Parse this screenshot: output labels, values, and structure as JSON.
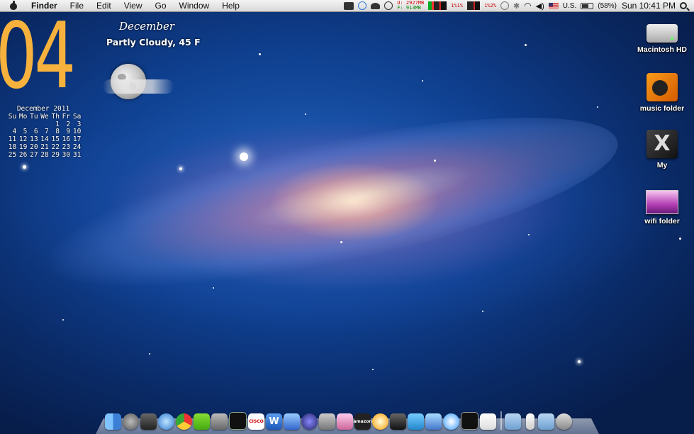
{
  "menubar": {
    "app_name": "Finder",
    "menus": [
      "File",
      "Edit",
      "View",
      "Go",
      "Window",
      "Help"
    ],
    "memory_used": "U: 2927MB",
    "memory_free": "F:  913MB",
    "cpu_1_a": "1%",
    "cpu_1_b": "1%",
    "cpu_2_a": "1%",
    "cpu_2_b": "2%",
    "input_source": "U.S.",
    "battery": "(58%)",
    "clock": "Sun 10:41 PM"
  },
  "date_widget": {
    "day": "04",
    "month_title": "December 2011",
    "weekdays": [
      "Su",
      "Mo",
      "Tu",
      "We",
      "Th",
      "Fr",
      "Sa"
    ],
    "weeks": [
      [
        "",
        "",
        "",
        "",
        "1",
        "2",
        "3"
      ],
      [
        "4",
        "5",
        "6",
        "7",
        "8",
        "9",
        "10"
      ],
      [
        "11",
        "12",
        "13",
        "14",
        "15",
        "16",
        "17"
      ],
      [
        "18",
        "19",
        "20",
        "21",
        "22",
        "23",
        "24"
      ],
      [
        "25",
        "26",
        "27",
        "28",
        "29",
        "30",
        "31"
      ]
    ]
  },
  "weather_widget": {
    "month": "December",
    "condition": "Partly Cloudy, 45 F",
    "icon": "moon-cloud-icon"
  },
  "desktop_icons": [
    {
      "label": "Macintosh HD",
      "icon": "hard-drive-icon"
    },
    {
      "label": "music folder",
      "icon": "music-folder-icon"
    },
    {
      "label": "My",
      "icon": "x-folder-icon"
    },
    {
      "label": "wifi folder",
      "icon": "wifi-folder-icon"
    }
  ],
  "dock": {
    "cisco_label": "CISCO",
    "amazon_label": "amazon"
  },
  "colors": {
    "date_accent": "#f6b23c",
    "desktop_blue": "#0f3f8f"
  }
}
